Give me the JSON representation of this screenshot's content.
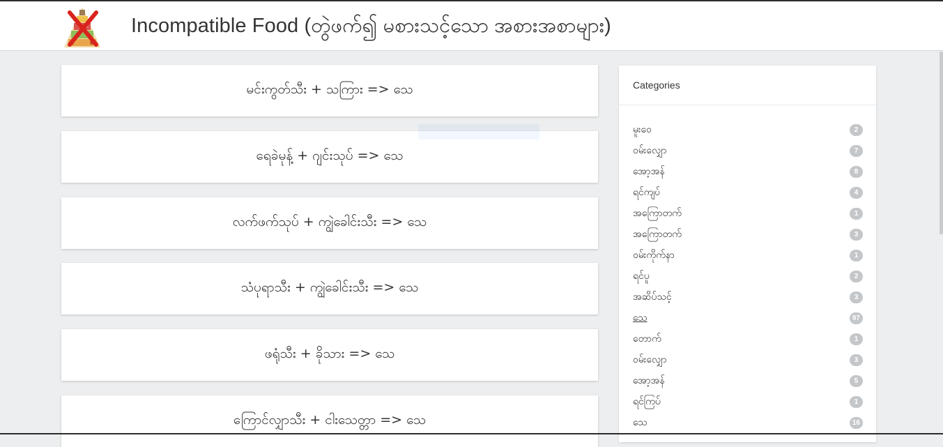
{
  "header": {
    "title": "Incompatible Food (တွဲဖက်၍ မစားသင့်သော အစားအစာများ)"
  },
  "posts": [
    {
      "text": "မင်းကွတ်သီး + သကြား => သေ"
    },
    {
      "text": "ရေခဲမုန့် + ဂျင်းသုပ် => သေ"
    },
    {
      "text": "လက်ဖက်သုပ် + ကျွဲခေါင်းသီး => သေ"
    },
    {
      "text": "သံပုရာသီး + ကျွဲခေါင်းသီး => သေ"
    },
    {
      "text": "ဖရုံသီး + ခိုသား => သေ"
    },
    {
      "text": "ကြောင်လျှာသီး + ငါးသေတ္တာ => သေ"
    }
  ],
  "sidebar": {
    "title": "Categories",
    "categories": [
      {
        "label": "မူးဝေ",
        "count": "2"
      },
      {
        "label": "ဝမ်းလျှော",
        "count": "7"
      },
      {
        "label": "အော့အန်",
        "count": "8"
      },
      {
        "label": "ရင်ကျပ်",
        "count": "4"
      },
      {
        "label": "အကြောတက်",
        "count": "1"
      },
      {
        "label": "အကြောတက်",
        "count": "3"
      },
      {
        "label": "ဝမ်းကိုက်နာ",
        "count": "1"
      },
      {
        "label": "ရင်ပူ",
        "count": "2"
      },
      {
        "label": "အဆိပ်သင့်",
        "count": "3"
      },
      {
        "label": "သေ",
        "count": "97"
      },
      {
        "label": "တောက်",
        "count": "1"
      },
      {
        "label": "ဝမ်းလျှော",
        "count": "3"
      },
      {
        "label": "အော့အန်",
        "count": "5"
      },
      {
        "label": "ရင်ကြပ်",
        "count": "1"
      },
      {
        "label": "သေ",
        "count": "16"
      }
    ]
  },
  "colors": {
    "page_bg": "#eceeef",
    "card_bg": "#ffffff",
    "badge_bg": "#c4c7ca",
    "text": "#333333",
    "logo_cross": "#d9231d"
  }
}
